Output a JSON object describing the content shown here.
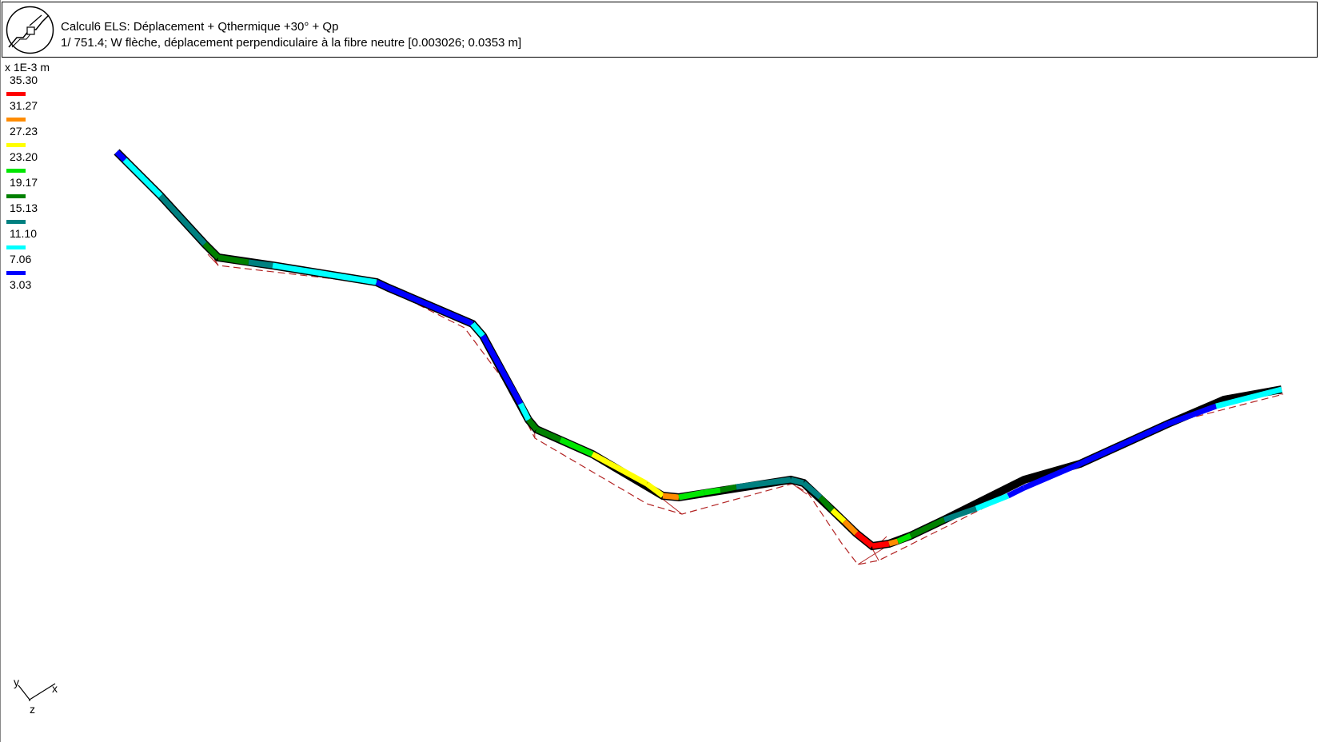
{
  "header": {
    "title": "Calcul6 ELS: Déplacement + Qthermique +30° + Qp",
    "subtitle": "1/ 751.4; W  flèche, déplacement perpendiculaire à la fibre neutre [0.003026; 0.0353 m]"
  },
  "legend": {
    "unit": "x 1E-3 m",
    "entries": [
      {
        "label": "35.30",
        "color": "#ff0000"
      },
      {
        "label": "31.27",
        "color": "#ff8c00"
      },
      {
        "label": "27.23",
        "color": "#ffff00"
      },
      {
        "label": "23.20",
        "color": "#00e600"
      },
      {
        "label": "19.17",
        "color": "#008000"
      },
      {
        "label": "15.13",
        "color": "#008080"
      },
      {
        "label": "11.10",
        "color": "#00ffff"
      },
      {
        "label": "7.06",
        "color": "#0000ff"
      },
      {
        "label": "3.03",
        "color": null
      }
    ]
  },
  "axes": {
    "x_label": "x",
    "y_label": "y",
    "z_label": "z"
  },
  "colors": {
    "deformed_outline": "#b22222",
    "beam_outline": "#000000"
  }
}
